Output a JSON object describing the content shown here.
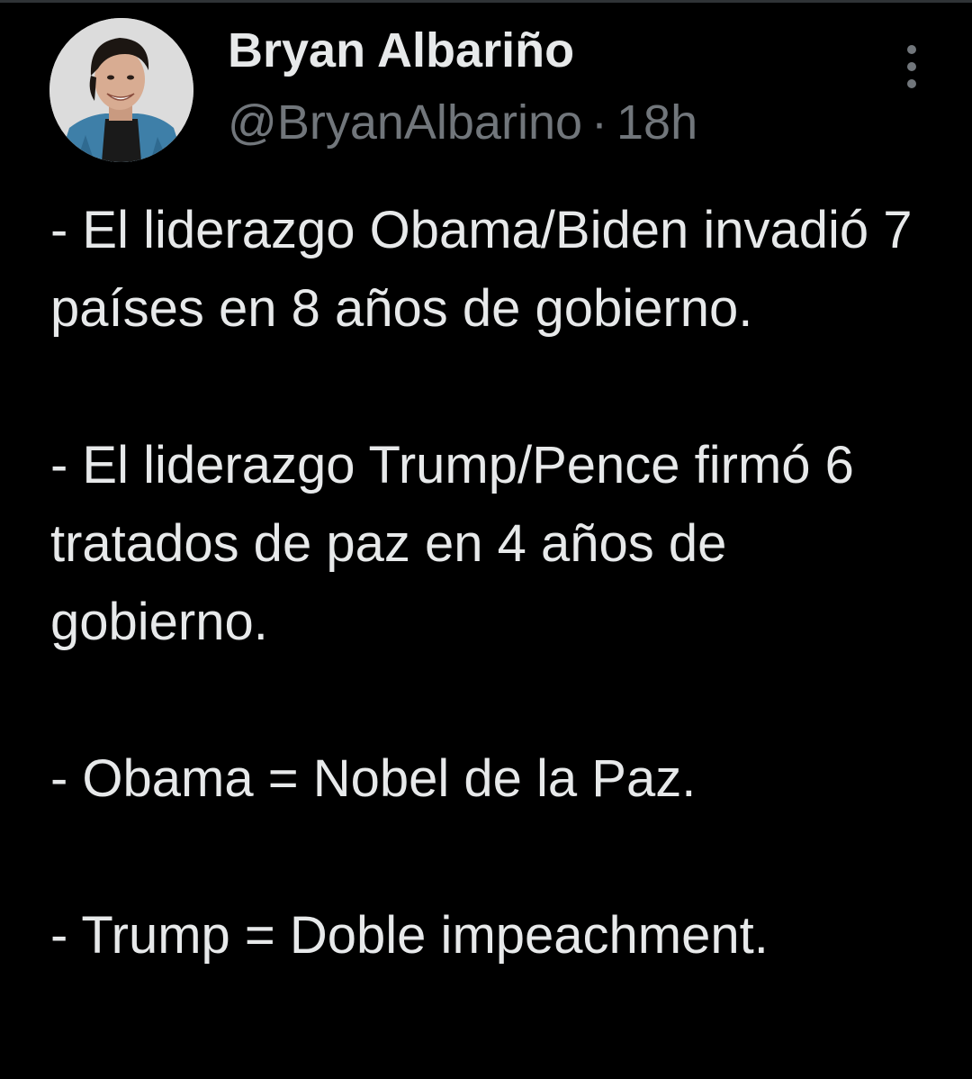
{
  "author": {
    "name": "Bryan Albariño",
    "handle": "@BryanAlbarino",
    "separator": "·",
    "time": "18h"
  },
  "icons": {
    "more": "more-vertical-icon"
  },
  "colors": {
    "background": "#000000",
    "text": "#e7e9ea",
    "secondary": "#71767b"
  },
  "tweet": {
    "paragraphs": [
      "- El liderazgo Obama/Biden invadió 7 países en 8 años de gobierno.",
      "- El liderazgo Trump/Pence firmó 6 tratados de paz en 4 años de gobierno.",
      "- Obama = Nobel de la Paz.",
      "- Trump = Doble impeachment."
    ]
  }
}
